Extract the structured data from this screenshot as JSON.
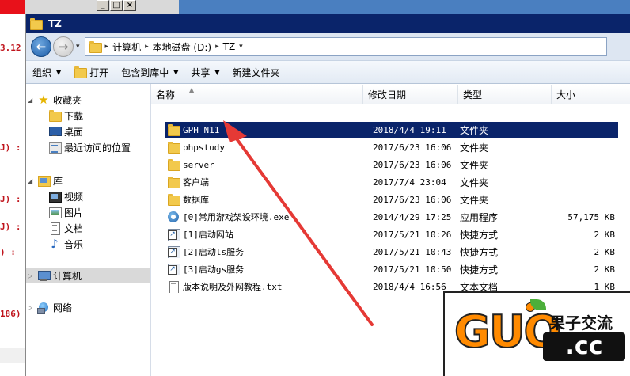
{
  "background": {
    "fragments": [
      "3.12",
      "J) :",
      "J) :",
      "J) :",
      ") :",
      "186)"
    ]
  },
  "window": {
    "title": "TZ",
    "address": {
      "crumbs": [
        "计算机",
        "本地磁盘 (D:)",
        "TZ"
      ]
    },
    "toolbar": {
      "organize": "组织",
      "open": "打开",
      "include_library": "包含到库中",
      "share": "共享",
      "new_folder": "新建文件夹"
    },
    "nav": {
      "favorites": "收藏夹",
      "favorites_items": [
        "下载",
        "桌面",
        "最近访问的位置"
      ],
      "libraries": "库",
      "library_items": [
        "视频",
        "图片",
        "文档",
        "音乐"
      ],
      "computer": "计算机",
      "network": "网络"
    },
    "columns": {
      "name": "名称",
      "date": "修改日期",
      "type": "类型",
      "size": "大小"
    },
    "files": [
      {
        "name": "GPH N11",
        "date": "2018/4/4 19:11",
        "type": "文件夹",
        "size": "",
        "icon": "folder-icon",
        "selected": true
      },
      {
        "name": "phpstudy",
        "date": "2017/6/23 16:06",
        "type": "文件夹",
        "size": "",
        "icon": "folder-icon"
      },
      {
        "name": "server",
        "date": "2017/6/23 16:06",
        "type": "文件夹",
        "size": "",
        "icon": "folder-icon"
      },
      {
        "name": "客户端",
        "date": "2017/7/4 23:04",
        "type": "文件夹",
        "size": "",
        "icon": "folder-icon"
      },
      {
        "name": "数据库",
        "date": "2017/6/23 16:06",
        "type": "文件夹",
        "size": "",
        "icon": "folder-icon"
      },
      {
        "name": "[0]常用游戏架设环境.exe",
        "date": "2014/4/29 17:25",
        "type": "应用程序",
        "size": "57,175 KB",
        "icon": "app-icon"
      },
      {
        "name": "[1]启动网站",
        "date": "2017/5/21 10:26",
        "type": "快捷方式",
        "size": "2 KB",
        "icon": "shortcut-icon"
      },
      {
        "name": "[2]启动ls服务",
        "date": "2017/5/21 10:43",
        "type": "快捷方式",
        "size": "2 KB",
        "icon": "shortcut-icon"
      },
      {
        "name": "[3]启动gs服务",
        "date": "2017/5/21 10:50",
        "type": "快捷方式",
        "size": "2 KB",
        "icon": "shortcut-icon"
      },
      {
        "name": "版本说明及外网教程.txt",
        "date": "2018/4/4 16:56",
        "type": "文本文档",
        "size": "1 KB",
        "icon": "textfile-icon"
      }
    ]
  },
  "watermark": {
    "logo": "GUO",
    "cn": "果子交流",
    "domain": ".cc"
  },
  "colors": {
    "selection": "#0a246a",
    "annotation_arrow": "#e53935",
    "watermark_orange": "#ff8a00"
  }
}
